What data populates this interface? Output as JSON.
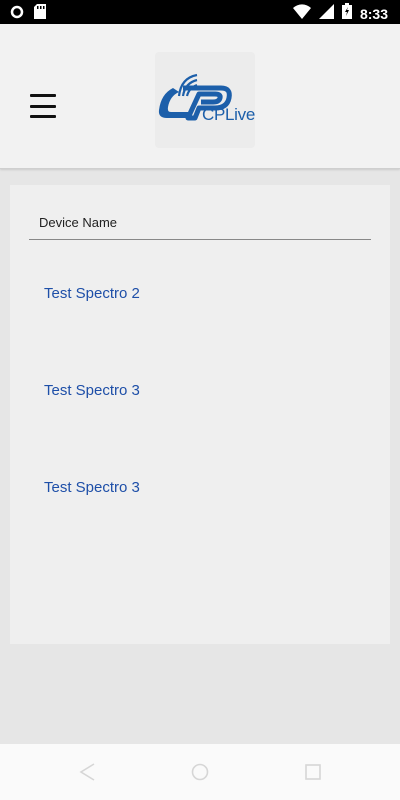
{
  "status_bar": {
    "time": "8:33"
  },
  "header": {
    "logo_text": "CPLive"
  },
  "device_list": {
    "field_label": "Device Name",
    "items": [
      {
        "label": "Test Spectro 2"
      },
      {
        "label": "Test Spectro 3"
      },
      {
        "label": "Test Spectro 3"
      }
    ]
  },
  "colors": {
    "accent": "#1e4fa8",
    "logo": "#1c5faa",
    "header_bg": "#f2f2f2",
    "page_bg": "#e6e6e6"
  },
  "icons": [
    "circle-icon",
    "sd-card-icon",
    "wifi-icon",
    "signal-icon",
    "battery-icon",
    "menu-icon",
    "back-icon",
    "home-icon",
    "recents-icon"
  ]
}
